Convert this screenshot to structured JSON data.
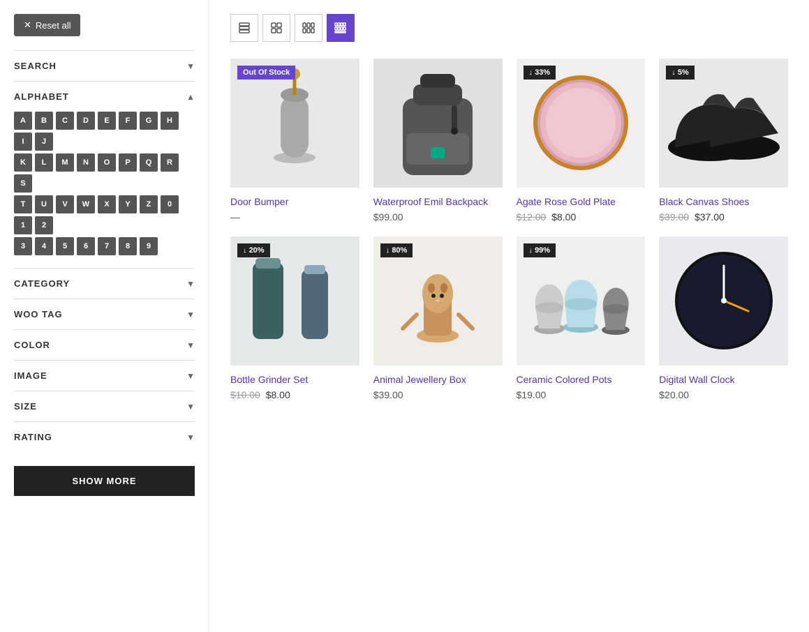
{
  "sidebar": {
    "reset_label": "Reset all",
    "filters": [
      {
        "id": "search",
        "label": "SEARCH",
        "expanded": false
      },
      {
        "id": "alphabet",
        "label": "ALPHABET",
        "expanded": true
      },
      {
        "id": "category",
        "label": "CATEGORY",
        "expanded": false
      },
      {
        "id": "woo_tag",
        "label": "WOO TAG",
        "expanded": false
      },
      {
        "id": "color",
        "label": "COLOR",
        "expanded": false
      },
      {
        "id": "image",
        "label": "IMAGE",
        "expanded": false
      },
      {
        "id": "size",
        "label": "SIZE",
        "expanded": false
      },
      {
        "id": "rating",
        "label": "RATING",
        "expanded": false
      }
    ],
    "alphabet_rows": [
      [
        "A",
        "B",
        "C",
        "D",
        "E",
        "F",
        "G",
        "H",
        "I",
        "J"
      ],
      [
        "K",
        "L",
        "M",
        "N",
        "O",
        "P",
        "Q",
        "R",
        "S"
      ],
      [
        "T",
        "U",
        "V",
        "W",
        "X",
        "Y",
        "Z",
        "0",
        "1",
        "2"
      ],
      [
        "3",
        "4",
        "5",
        "6",
        "7",
        "8",
        "9"
      ]
    ],
    "show_more_label": "SHOW MORE"
  },
  "toolbar": {
    "views": [
      {
        "id": "list",
        "label": "List view"
      },
      {
        "id": "grid2",
        "label": "2-column grid"
      },
      {
        "id": "grid3",
        "label": "3-column grid"
      },
      {
        "id": "grid4",
        "label": "4-column grid",
        "active": true
      }
    ]
  },
  "products": [
    {
      "id": 1,
      "name": "Door Bumper",
      "badge": "Out Of Stock",
      "badge_type": "out",
      "price_regular": "$",
      "price": "—",
      "link": "#",
      "image_class": "img-door-bumper",
      "image_emoji": "🪨"
    },
    {
      "id": 2,
      "name": "Waterproof Emil Backpack",
      "badge": null,
      "price_display": "$99.00",
      "link": "#",
      "image_class": "img-backpack",
      "image_emoji": "🎒"
    },
    {
      "id": 3,
      "name": "Agate Rose Gold Plate",
      "badge": "33%",
      "badge_type": "discount",
      "price_original": "$12.00",
      "price_sale": "$8.00",
      "link": "#",
      "image_class": "img-plate",
      "image_emoji": "🍽️"
    },
    {
      "id": 4,
      "name": "Black Canvas Shoes",
      "badge": "5%",
      "badge_type": "discount",
      "price_original": "$39.00",
      "price_sale": "$37.00",
      "link": "#",
      "image_class": "img-shoes",
      "image_emoji": "👟"
    },
    {
      "id": 5,
      "name": "Bottle Grinder Set",
      "badge": "20%",
      "badge_type": "discount",
      "price_original": "$10.00",
      "price_sale": "$8.00",
      "link": "#",
      "image_class": "img-grinder",
      "image_emoji": "🫙"
    },
    {
      "id": 6,
      "name": "Animal Jewellery Box",
      "badge": "80%",
      "badge_type": "discount",
      "price_display": "$39.00",
      "link": "#",
      "image_class": "img-animal",
      "image_emoji": "🦙"
    },
    {
      "id": 7,
      "name": "Ceramic Colored Pots",
      "badge": "99%",
      "badge_type": "discount",
      "price_display": "$19.00",
      "link": "#",
      "image_class": "img-pots",
      "image_emoji": "🏺"
    },
    {
      "id": 8,
      "name": "Digital Wall Clock",
      "badge": null,
      "price_display": "$20.00",
      "link": "#",
      "image_class": "img-clock",
      "image_emoji": "🕐"
    }
  ]
}
